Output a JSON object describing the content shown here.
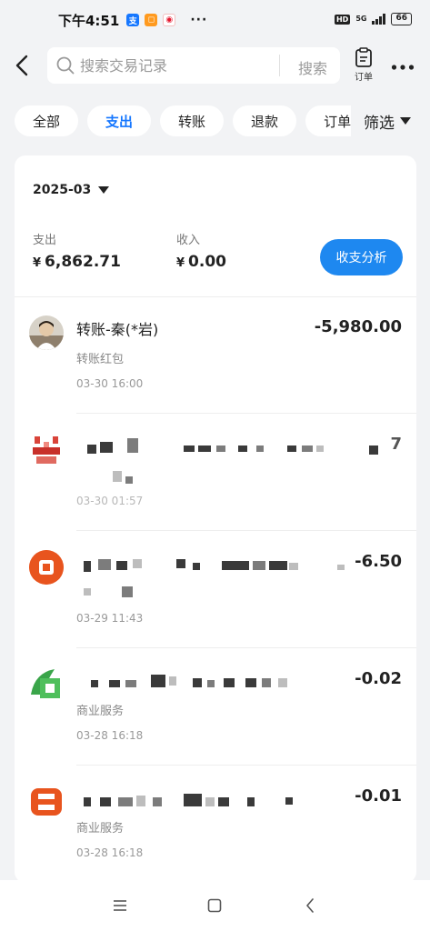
{
  "status_bar": {
    "time": "下午4:51",
    "network": "5G",
    "battery": "66"
  },
  "header": {
    "search_placeholder": "搜索交易记录",
    "search_button": "搜索",
    "orders_label": "订单"
  },
  "tabs": [
    {
      "label": "全部",
      "active": false
    },
    {
      "label": "支出",
      "active": true
    },
    {
      "label": "转账",
      "active": false
    },
    {
      "label": "退款",
      "active": false
    },
    {
      "label": "订单",
      "active": false
    }
  ],
  "filter_label": "筛选",
  "summary": {
    "month": "2025-03",
    "expense_title": "支出",
    "expense_currency": "¥",
    "expense_value": "6,862.71",
    "income_title": "收入",
    "income_currency": "¥",
    "income_value": "0.00",
    "analysis_button": "收支分析"
  },
  "transactions": [
    {
      "title": "转账-秦(*岩)",
      "subtitle": "转账红包",
      "time": "03-30 16:00",
      "amount": "-5,980.00"
    },
    {
      "title": "",
      "subtitle": "",
      "time": "03-30 01:57",
      "amount": "7"
    },
    {
      "title": "",
      "subtitle": "",
      "time": "03-29 11:43",
      "amount": "-6.50"
    },
    {
      "title": "",
      "subtitle": "商业服务",
      "time": "03-28 16:18",
      "amount": "-0.02"
    },
    {
      "title": "",
      "subtitle": "商业服务",
      "time": "03-28 16:18",
      "amount": "-0.01"
    }
  ],
  "colors": {
    "accent": "#1e88f0",
    "active_tab": "#1677ff",
    "background": "#f2f3f5"
  }
}
